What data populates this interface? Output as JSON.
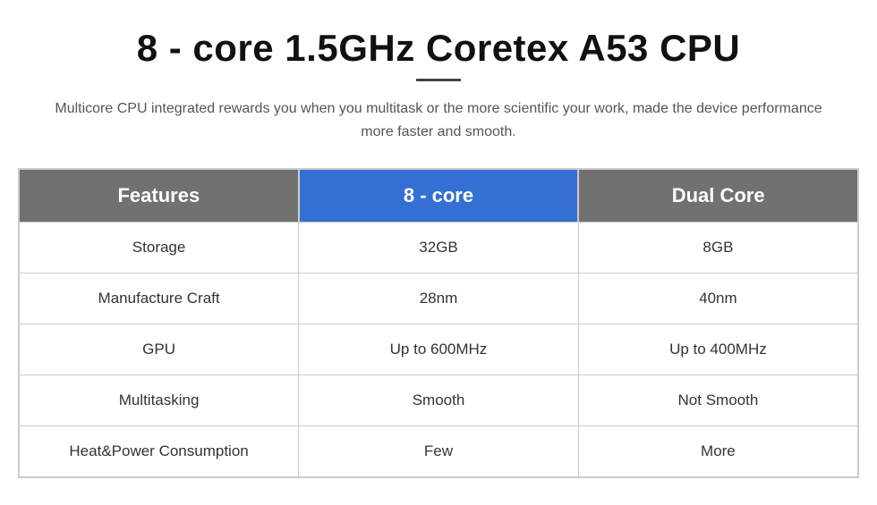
{
  "header": {
    "title": "8 - core 1.5GHz Coretex A53 CPU",
    "divider": true,
    "subtitle": "Multicore CPU integrated rewards you when you multitask or the more scientific your work, made the device performance more faster and smooth."
  },
  "table": {
    "columns": {
      "features": "Features",
      "core8": "8 - core",
      "dualcore": "Dual Core"
    },
    "rows": [
      {
        "feature": "Storage",
        "core8_value": "32GB",
        "dual_value": "8GB"
      },
      {
        "feature": "Manufacture Craft",
        "core8_value": "28nm",
        "dual_value": "40nm"
      },
      {
        "feature": "GPU",
        "core8_value": "Up to 600MHz",
        "dual_value": "Up to 400MHz"
      },
      {
        "feature": "Multitasking",
        "core8_value": "Smooth",
        "dual_value": "Not Smooth"
      },
      {
        "feature": "Heat&Power Consumption",
        "core8_value": "Few",
        "dual_value": "More"
      }
    ]
  }
}
